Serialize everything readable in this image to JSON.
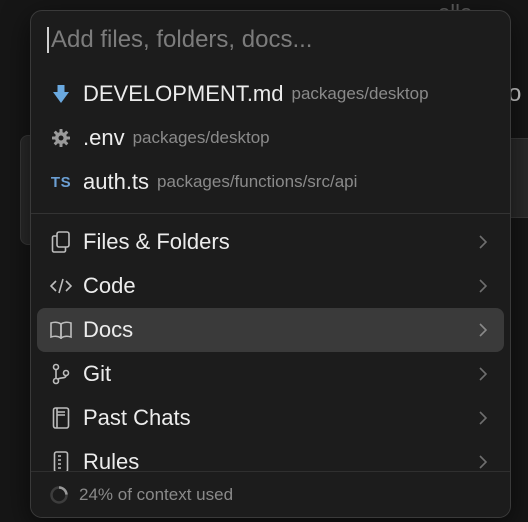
{
  "background": {
    "top_fragment": "ollo",
    "right_fragment": "o"
  },
  "search": {
    "placeholder": "Add files, folders, docs...",
    "value": ""
  },
  "recent_files": [
    {
      "name": "DEVELOPMENT.md",
      "path": "packages/desktop",
      "icon": "download-arrow-icon"
    },
    {
      "name": ".env",
      "path": "packages/desktop",
      "icon": "gear-icon"
    },
    {
      "name": "auth.ts",
      "path": "packages/functions/src/api",
      "icon": "typescript-icon",
      "badge": "TS"
    }
  ],
  "menu": [
    {
      "label": "Files & Folders",
      "icon": "copy-files-icon",
      "active": false
    },
    {
      "label": "Code",
      "icon": "code-icon",
      "active": false
    },
    {
      "label": "Docs",
      "icon": "book-icon",
      "active": true
    },
    {
      "label": "Git",
      "icon": "git-branch-icon",
      "active": false
    },
    {
      "label": "Past Chats",
      "icon": "notebook-icon",
      "active": false
    },
    {
      "label": "Rules",
      "icon": "rules-icon",
      "active": false
    }
  ],
  "footer": {
    "context_text": "24% of context used",
    "context_percent": 24
  },
  "colors": {
    "panel_bg": "#1c1c1c",
    "active_bg": "#3a3a3a",
    "md_icon": "#6aa9e0",
    "ts_badge": "#6b9fd4"
  }
}
